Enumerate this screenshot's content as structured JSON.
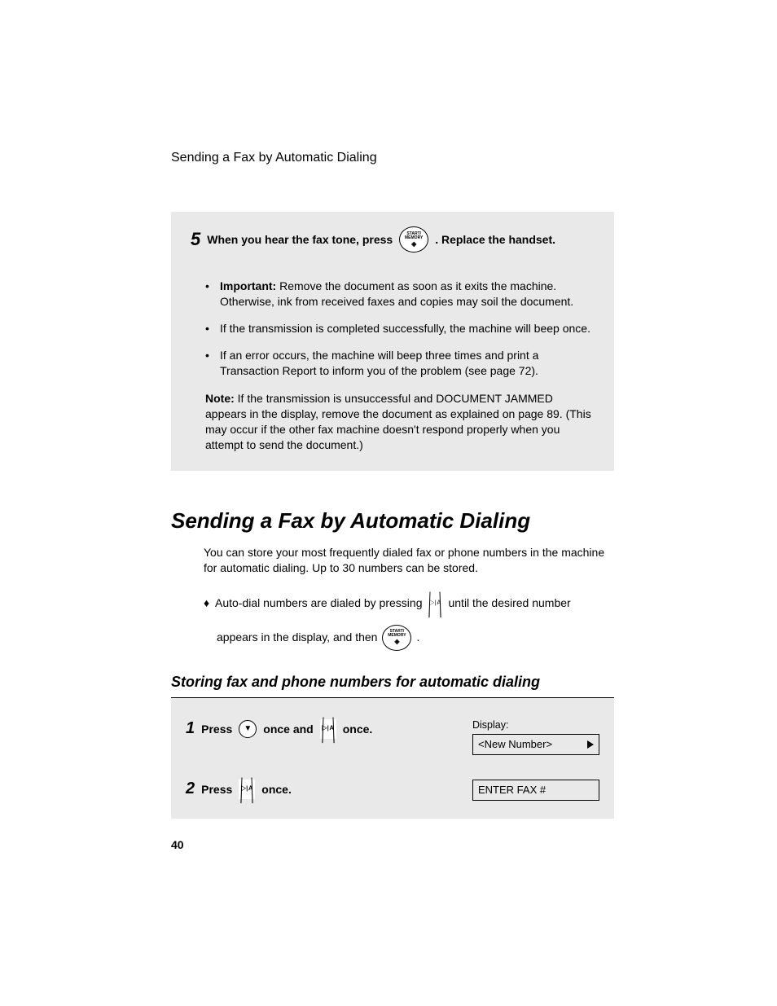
{
  "running_head": "Sending a Fax by Automatic Dialing",
  "step5": {
    "num": "5",
    "text_before": "When you hear the fax tone, press",
    "text_after": ". Replace the handset.",
    "bullets": [
      {
        "bold": "Important:",
        "text": " Remove the document as soon as it exits the machine. Otherwise, ink from received faxes and copies may soil the document."
      },
      {
        "bold": "",
        "text": "If the transmission is completed successfully, the machine will beep once."
      },
      {
        "bold": "",
        "text": "If an error occurs, the machine will beep three times and print a Transaction Report to inform you of the problem (see page 72)."
      }
    ],
    "note_bold": "Note:",
    "note_text": " If the transmission is unsuccessful and DOCUMENT JAMMED appears in the display, remove the document as explained on page 89. (This may occur if the other fax machine doesn't respond properly when you attempt to send the document.)"
  },
  "heading": "Sending a Fax by Automatic Dialing",
  "intro": "You can store your most frequently dialed fax or phone numbers in the machine for automatic dialing. Up to 30 numbers can be stored.",
  "auto_a": "Auto-dial numbers are dialed by pressing",
  "auto_b": "until the desired number",
  "auto_c": "appears in the display, and then",
  "subheading": "Storing fax and phone numbers for automatic dialing",
  "proc": {
    "display_label": "Display:",
    "row1": {
      "num": "1",
      "press": "Press",
      "once_and": "once and",
      "once": "once.",
      "display": "<New Number>"
    },
    "row2": {
      "num": "2",
      "press": "Press",
      "once": "once.",
      "display": "ENTER FAX #"
    }
  },
  "icons": {
    "start_memory_top": "START/",
    "start_memory_mid": "MEMORY",
    "nav": "▷|Ａ",
    "triangle": "▼"
  },
  "page_number": "40"
}
